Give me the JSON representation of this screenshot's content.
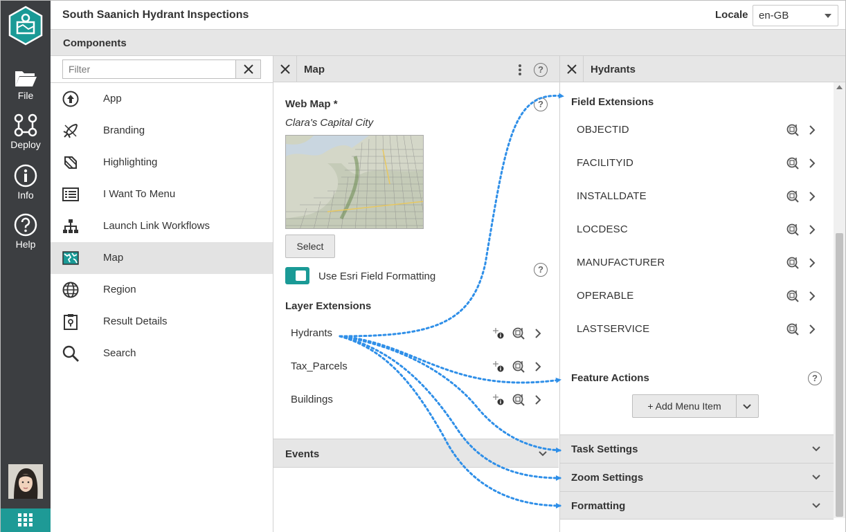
{
  "header": {
    "app_title": "South Saanich Hydrant Inspections",
    "locale_label": "Locale",
    "locale_value": "en-GB"
  },
  "rail": {
    "items": [
      {
        "label": "File",
        "icon": "folder-icon"
      },
      {
        "label": "Deploy",
        "icon": "deploy-icon"
      },
      {
        "label": "Info",
        "icon": "info-icon"
      },
      {
        "label": "Help",
        "icon": "help-icon"
      }
    ]
  },
  "components": {
    "title": "Components",
    "filter_placeholder": "Filter",
    "items": [
      {
        "label": "App",
        "icon": "upload-circle-icon"
      },
      {
        "label": "Branding",
        "icon": "rocket-icon"
      },
      {
        "label": "Highlighting",
        "icon": "highlight-icon"
      },
      {
        "label": "I Want To Menu",
        "icon": "menu-list-icon"
      },
      {
        "label": "Launch Link Workflows",
        "icon": "sitemap-icon"
      },
      {
        "label": "Map",
        "icon": "map-icon",
        "active": true
      },
      {
        "label": "Region",
        "icon": "globe-icon"
      },
      {
        "label": "Result Details",
        "icon": "clipboard-icon"
      },
      {
        "label": "Search",
        "icon": "search-icon"
      }
    ]
  },
  "map_panel": {
    "title": "Map",
    "web_map_label": "Web Map *",
    "web_map_name": "Clara's Capital City",
    "select_label": "Select",
    "toggle_label": "Use Esri Field Formatting",
    "layer_extensions_label": "Layer Extensions",
    "layers": [
      {
        "name": "Hydrants"
      },
      {
        "name": "Tax_Parcels"
      },
      {
        "name": "Buildings"
      }
    ],
    "events_label": "Events"
  },
  "hydrants_panel": {
    "title": "Hydrants",
    "field_extensions_label": "Field Extensions",
    "fields": [
      "OBJECTID",
      "FACILITYID",
      "INSTALLDATE",
      "LOCDESC",
      "MANUFACTURER",
      "OPERABLE",
      "LASTSERVICE"
    ],
    "feature_actions_label": "Feature Actions",
    "add_menu_item_label": "+ Add Menu Item",
    "sections": [
      "Task Settings",
      "Zoom Settings",
      "Formatting"
    ]
  },
  "colors": {
    "rail": "#3c3e41",
    "accent": "#1a9a96",
    "arrow": "#2f8fe8"
  }
}
